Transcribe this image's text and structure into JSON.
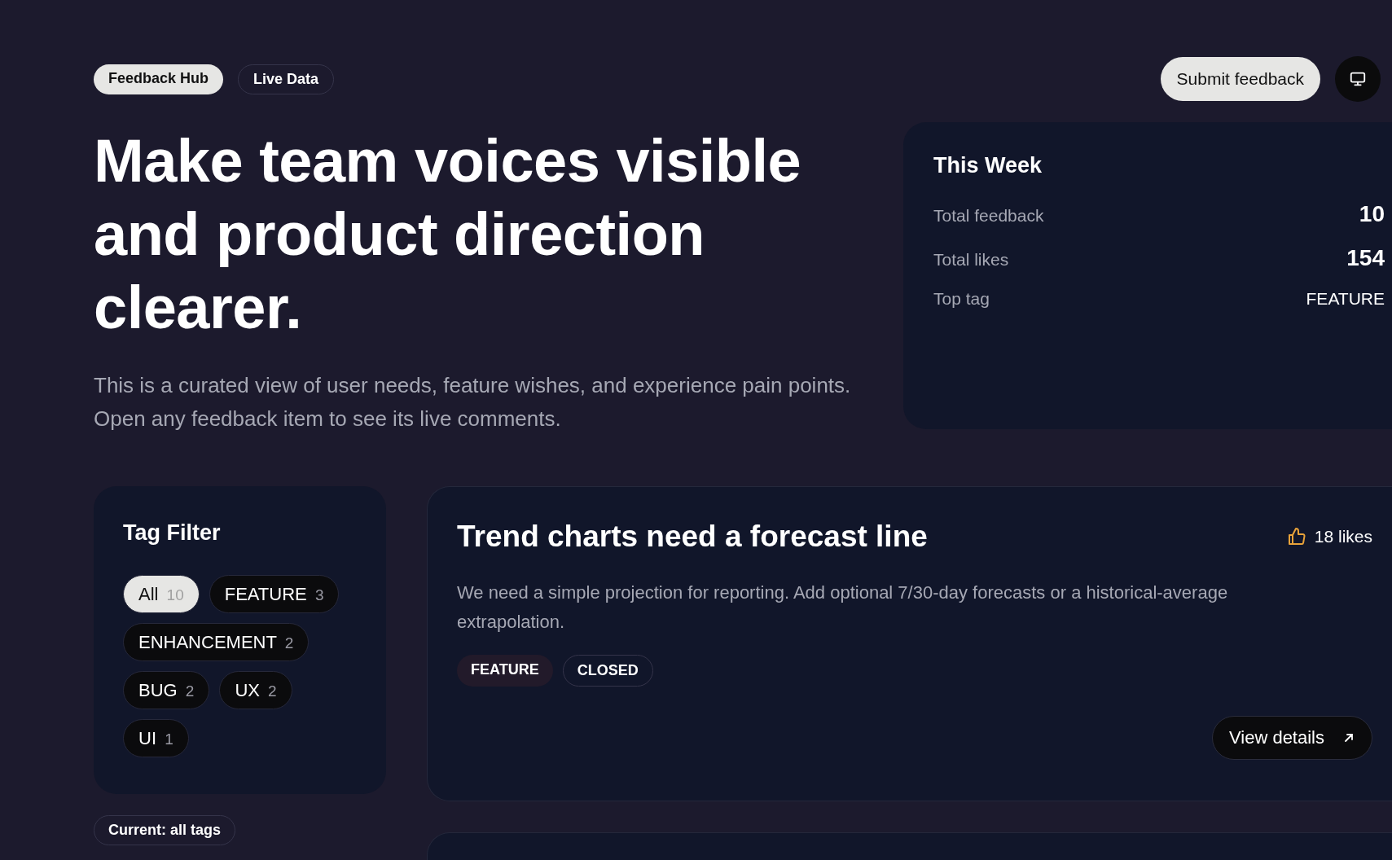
{
  "header": {
    "badges": [
      {
        "label": "Feedback Hub",
        "kind": "brand"
      },
      {
        "label": "Live Data",
        "kind": "status"
      }
    ],
    "submit_button": "Submit feedback"
  },
  "hero": {
    "title": "Make team voices visible and product direction clearer.",
    "subtitle": "This is a curated view of user needs, feature wishes, and experience pain points. Open any feedback item to see its live comments."
  },
  "summary": {
    "title": "This Week",
    "stats": [
      {
        "label": "Total feedback",
        "value": "10",
        "kind": "number"
      },
      {
        "label": "Total likes",
        "value": "154",
        "kind": "number"
      },
      {
        "label": "Top tag",
        "value": "FEATURE",
        "kind": "tag"
      }
    ]
  },
  "tag_filter": {
    "title": "Tag Filter",
    "tags": [
      {
        "label": "All",
        "count": "10",
        "selected": true
      },
      {
        "label": "FEATURE",
        "count": "3",
        "selected": false
      },
      {
        "label": "ENHANCEMENT",
        "count": "2",
        "selected": false
      },
      {
        "label": "BUG",
        "count": "2",
        "selected": false
      },
      {
        "label": "UX",
        "count": "2",
        "selected": false
      },
      {
        "label": "UI",
        "count": "1",
        "selected": false
      }
    ],
    "current": "Current: all tags"
  },
  "feedback": [
    {
      "title": "Trend charts need a forecast line",
      "likes": "18 likes",
      "description": "We need a simple projection for reporting. Add optional 7/30-day forecasts or a historical-average extrapolation.",
      "tags": [
        {
          "label": "FEATURE",
          "kind": "category"
        },
        {
          "label": "CLOSED",
          "kind": "status"
        }
      ],
      "button": "View details"
    }
  ]
}
